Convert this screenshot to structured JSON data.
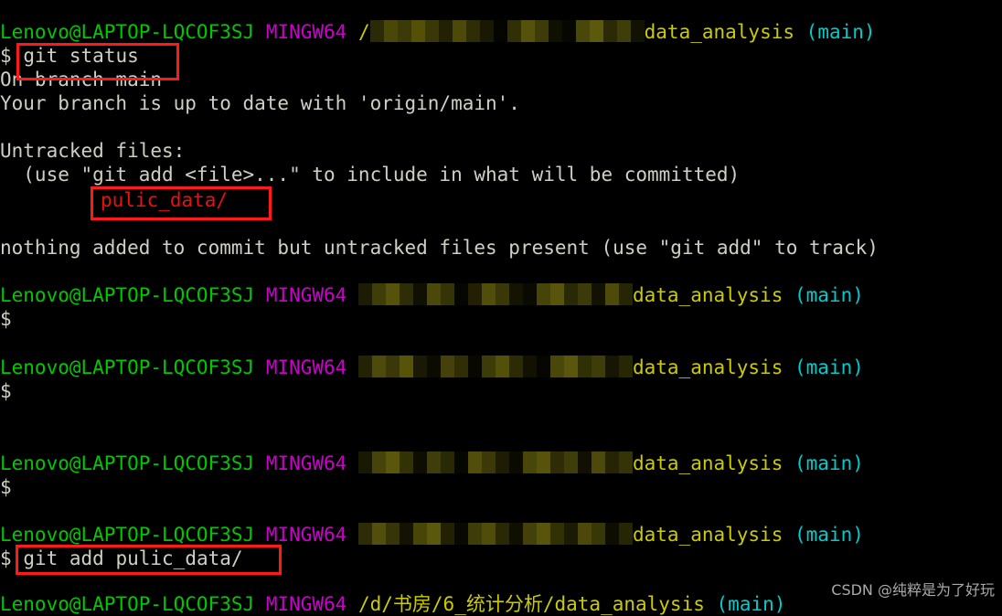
{
  "terminal": {
    "shell": "MINGW64",
    "user_host": "Lenovo@LAPTOP-LQCOF3SJ",
    "repo": "data_analysis",
    "branch": "(main)",
    "prompt_symbol": "$",
    "colors": {
      "background": "#000000",
      "user_host": "#00c800",
      "shell": "#cc00cc",
      "repo": "#cbcb00",
      "branch": "#00cccc",
      "output": "#cfd0c2",
      "highlight_box": "#ff1a1a",
      "red_text": "#e81010"
    }
  },
  "lines": {
    "l1_prompt_path_redacted": "",
    "l2_command": "git status",
    "l3_branch": "On branch main",
    "l4_uptodate": "Your branch is up to date with 'origin/main'.",
    "l5_untracked_header": "Untracked files:",
    "l6_hint": "  (use \"git add <file>...\" to include in what will be committed)",
    "l7_untracked_entry": "pulic_data/",
    "l8_nothing_added": "nothing added to commit but untracked files present (use \"git add\" to track)",
    "l_last_command": "git add pulic_data/",
    "last_path_visible": "/d/书房/6_统计分析/"
  },
  "highlights": [
    {
      "label": "git status",
      "note": "red rectangle around typed command"
    },
    {
      "label": "pulic_data/",
      "note": "red rectangle around untracked directory"
    },
    {
      "label": "git add pulic_data/",
      "note": "red rectangle around typed command"
    }
  ],
  "watermark": {
    "text": "CSDN @纯粹是为了好玩"
  }
}
